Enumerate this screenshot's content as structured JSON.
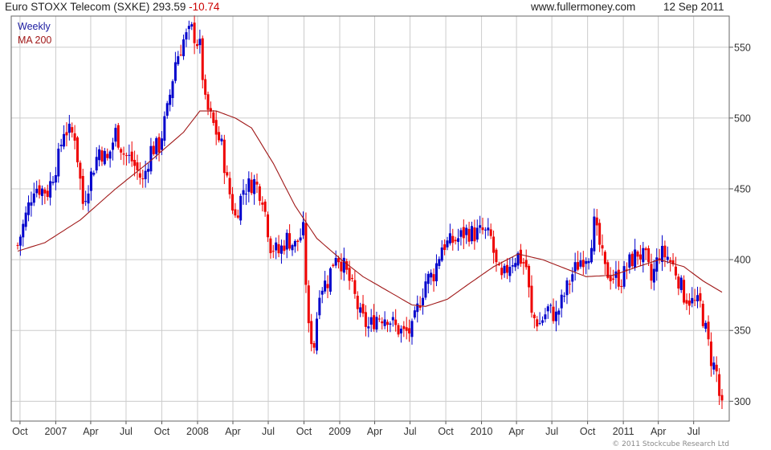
{
  "header": {
    "instrument": "Euro STOXX Telecom (SXKE)",
    "last": "293.59",
    "change": "-10.74",
    "website": "www.fullermoney.com",
    "date": "12 Sep 2011"
  },
  "copyright": "© 2011 Stockcube Research Ltd",
  "colors": {
    "up": "#0000cc",
    "down": "#ee0000",
    "ma": "#a01818",
    "grid": "#cccccc",
    "weekly_label": "#1a1aa0",
    "ma_label": "#a01818"
  },
  "chart_data": {
    "type": "candlestick",
    "title": "Euro STOXX Telecom (SXKE) 293.59 -10.74",
    "y_axis": {
      "side": "right",
      "ticks": [
        300,
        350,
        400,
        450,
        500,
        550
      ],
      "ylim": [
        286,
        572
      ]
    },
    "x_axis": {
      "range": [
        "2006-09-25",
        "2011-09-12"
      ],
      "ticks": [
        {
          "date": "2006-10-01",
          "label": "Oct"
        },
        {
          "date": "2007-01-01",
          "label": "2007"
        },
        {
          "date": "2007-04-01",
          "label": "Apr"
        },
        {
          "date": "2007-07-01",
          "label": "Jul"
        },
        {
          "date": "2007-10-01",
          "label": "Oct"
        },
        {
          "date": "2008-01-01",
          "label": "2008"
        },
        {
          "date": "2008-04-01",
          "label": "Apr"
        },
        {
          "date": "2008-07-01",
          "label": "Jul"
        },
        {
          "date": "2008-10-01",
          "label": "Oct"
        },
        {
          "date": "2009-01-01",
          "label": "2009"
        },
        {
          "date": "2009-04-01",
          "label": "Apr"
        },
        {
          "date": "2009-07-01",
          "label": "Jul"
        },
        {
          "date": "2009-10-01",
          "label": "Oct"
        },
        {
          "date": "2010-01-01",
          "label": "2010"
        },
        {
          "date": "2010-04-01",
          "label": "Apr"
        },
        {
          "date": "2010-07-01",
          "label": "Jul"
        },
        {
          "date": "2010-10-01",
          "label": "Oct"
        },
        {
          "date": "2011-01-01",
          "label": "2011"
        },
        {
          "date": "2011-04-01",
          "label": "Apr"
        },
        {
          "date": "2011-07-01",
          "label": "Jul"
        }
      ]
    },
    "grid": true,
    "legend": [
      "Weekly",
      "MA 200"
    ],
    "legend_position": "top-left",
    "weekly_close_anchors": [
      [
        "2006-09-25",
        410
      ],
      [
        "2006-11-06",
        452
      ],
      [
        "2006-12-11",
        448
      ],
      [
        "2007-01-08",
        472
      ],
      [
        "2007-01-22",
        492
      ],
      [
        "2007-02-19",
        488
      ],
      [
        "2007-03-12",
        440
      ],
      [
        "2007-04-02",
        460
      ],
      [
        "2007-04-23",
        478
      ],
      [
        "2007-05-14",
        470
      ],
      [
        "2007-06-04",
        490
      ],
      [
        "2007-06-25",
        475
      ],
      [
        "2007-07-16",
        470
      ],
      [
        "2007-08-13",
        455
      ],
      [
        "2007-09-03",
        478
      ],
      [
        "2007-09-24",
        480
      ],
      [
        "2007-10-15",
        505
      ],
      [
        "2007-11-05",
        540
      ],
      [
        "2007-11-26",
        555
      ],
      [
        "2007-12-17",
        562
      ],
      [
        "2008-01-07",
        550
      ],
      [
        "2008-01-21",
        510
      ],
      [
        "2008-02-11",
        495
      ],
      [
        "2008-03-03",
        480
      ],
      [
        "2008-03-17",
        455
      ],
      [
        "2008-04-07",
        430
      ],
      [
        "2008-04-28",
        450
      ],
      [
        "2008-05-26",
        455
      ],
      [
        "2008-06-16",
        445
      ],
      [
        "2008-07-07",
        410
      ],
      [
        "2008-07-28",
        405
      ],
      [
        "2008-08-18",
        415
      ],
      [
        "2008-09-08",
        410
      ],
      [
        "2008-09-29",
        420
      ],
      [
        "2008-10-13",
        350
      ],
      [
        "2008-10-27",
        340
      ],
      [
        "2008-11-10",
        380
      ],
      [
        "2008-12-01",
        385
      ],
      [
        "2008-12-22",
        405
      ],
      [
        "2009-01-12",
        395
      ],
      [
        "2009-02-02",
        380
      ],
      [
        "2009-02-23",
        360
      ],
      [
        "2009-03-16",
        352
      ],
      [
        "2009-04-06",
        360
      ],
      [
        "2009-05-04",
        360
      ],
      [
        "2009-05-25",
        352
      ],
      [
        "2009-06-15",
        348
      ],
      [
        "2009-07-06",
        350
      ],
      [
        "2009-07-20",
        365
      ],
      [
        "2009-08-10",
        385
      ],
      [
        "2009-08-31",
        390
      ],
      [
        "2009-09-21",
        410
      ],
      [
        "2009-10-12",
        412
      ],
      [
        "2009-11-02",
        415
      ],
      [
        "2009-11-23",
        420
      ],
      [
        "2009-12-14",
        418
      ],
      [
        "2010-01-04",
        420
      ],
      [
        "2010-01-25",
        415
      ],
      [
        "2010-02-08",
        395
      ],
      [
        "2010-02-22",
        385
      ],
      [
        "2010-03-15",
        398
      ],
      [
        "2010-04-05",
        403
      ],
      [
        "2010-04-26",
        395
      ],
      [
        "2010-05-10",
        360
      ],
      [
        "2010-05-31",
        355
      ],
      [
        "2010-06-21",
        365
      ],
      [
        "2010-07-12",
        360
      ],
      [
        "2010-08-02",
        375
      ],
      [
        "2010-08-23",
        390
      ],
      [
        "2010-09-13",
        400
      ],
      [
        "2010-10-04",
        405
      ],
      [
        "2010-10-18",
        425
      ],
      [
        "2010-11-01",
        410
      ],
      [
        "2010-11-15",
        392
      ],
      [
        "2010-12-06",
        388
      ],
      [
        "2010-12-27",
        386
      ],
      [
        "2011-01-17",
        398
      ],
      [
        "2011-02-07",
        405
      ],
      [
        "2011-02-28",
        400
      ],
      [
        "2011-03-14",
        385
      ],
      [
        "2011-04-04",
        405
      ],
      [
        "2011-04-25",
        402
      ],
      [
        "2011-05-16",
        392
      ],
      [
        "2011-06-06",
        375
      ],
      [
        "2011-06-27",
        370
      ],
      [
        "2011-07-18",
        368
      ],
      [
        "2011-08-01",
        350
      ],
      [
        "2011-08-15",
        330
      ],
      [
        "2011-08-29",
        320
      ],
      [
        "2011-09-05",
        304
      ],
      [
        "2011-09-12",
        294
      ]
    ],
    "ma200_anchors": [
      [
        "2006-09-25",
        406
      ],
      [
        "2006-12-04",
        412
      ],
      [
        "2007-03-05",
        428
      ],
      [
        "2007-06-04",
        450
      ],
      [
        "2007-09-03",
        470
      ],
      [
        "2007-11-26",
        490
      ],
      [
        "2008-01-07",
        505
      ],
      [
        "2008-02-18",
        505
      ],
      [
        "2008-04-07",
        500
      ],
      [
        "2008-05-19",
        493
      ],
      [
        "2008-07-14",
        468
      ],
      [
        "2008-09-08",
        438
      ],
      [
        "2008-11-03",
        415
      ],
      [
        "2009-01-05",
        400
      ],
      [
        "2009-03-02",
        388
      ],
      [
        "2009-05-04",
        378
      ],
      [
        "2009-07-06",
        368
      ],
      [
        "2009-08-10",
        367
      ],
      [
        "2009-10-05",
        372
      ],
      [
        "2009-11-30",
        383
      ],
      [
        "2010-02-01",
        395
      ],
      [
        "2010-04-05",
        404
      ],
      [
        "2010-06-07",
        400
      ],
      [
        "2010-08-02",
        394
      ],
      [
        "2010-09-27",
        388
      ],
      [
        "2010-12-06",
        389
      ],
      [
        "2011-02-07",
        395
      ],
      [
        "2011-04-04",
        400
      ],
      [
        "2011-06-06",
        395
      ],
      [
        "2011-07-25",
        385
      ],
      [
        "2011-09-12",
        377
      ]
    ]
  },
  "legend_labels": {
    "weekly": "Weekly",
    "ma": "MA 200"
  }
}
